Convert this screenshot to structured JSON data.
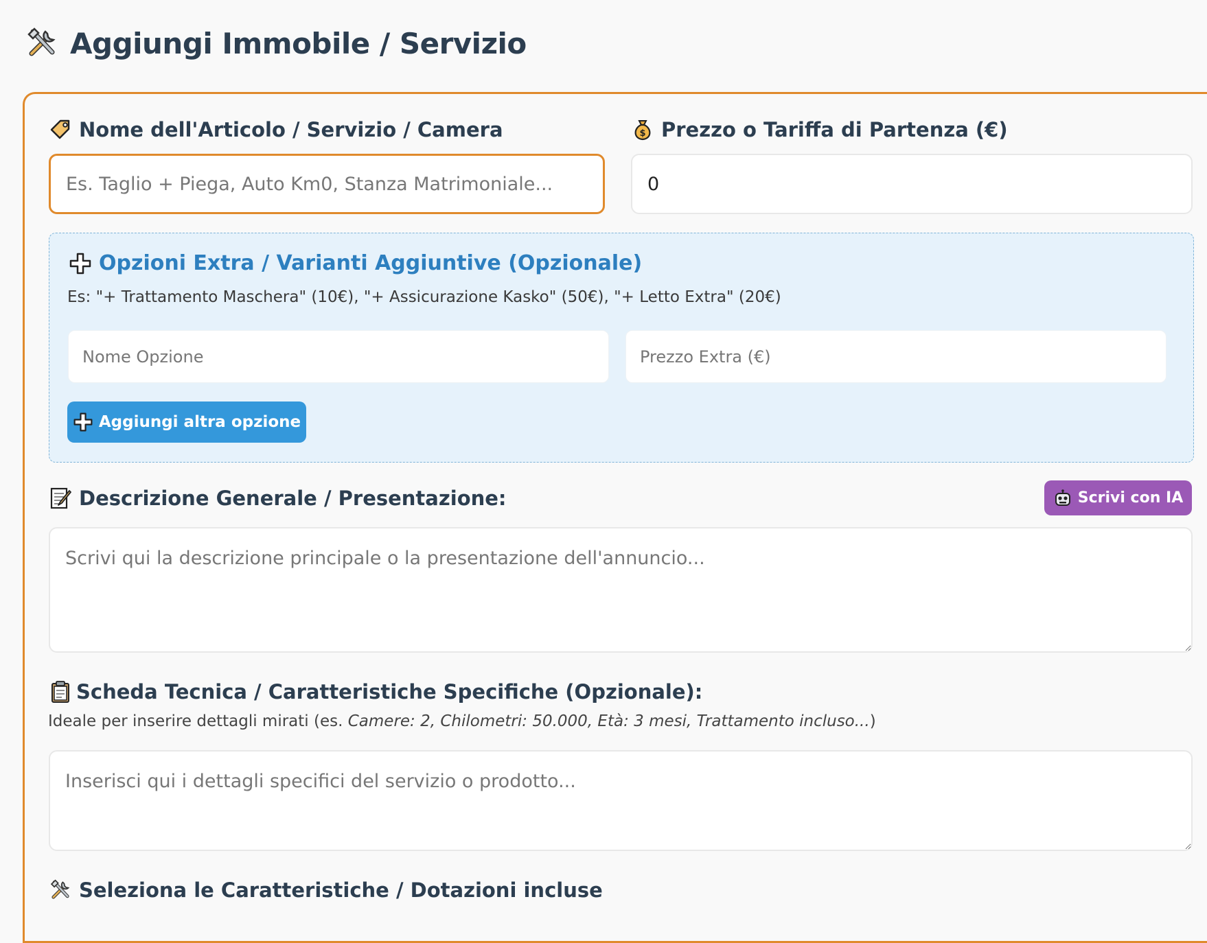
{
  "page": {
    "title": "Aggiungi Immobile / Servizio",
    "title_icon": "tools-icon"
  },
  "form": {
    "name_field": {
      "label": "Nome dell'Articolo / Servizio / Camera",
      "icon": "tag-icon",
      "value": "",
      "placeholder": "Es. Taglio + Piega, Auto Km0, Stanza Matrimoniale..."
    },
    "price_field": {
      "label": "Prezzo o Tariffa di Partenza (€)",
      "icon": "money-bag-icon",
      "value": "0",
      "placeholder": ""
    },
    "extras": {
      "title": "Opzioni Extra / Varianti Aggiuntive (Opzionale)",
      "icon": "plus-icon",
      "hint": "Es: \"+ Trattamento Maschera\" (10€), \"+ Assicurazione Kasko\" (50€), \"+ Letto Extra\" (20€)",
      "option_name_placeholder": "Nome Opzione",
      "option_price_placeholder": "Prezzo Extra (€)",
      "add_button": "Aggiungi altra opzione"
    },
    "description": {
      "label": "Descrizione Generale / Presentazione:",
      "icon": "memo-icon",
      "ai_button": "Scrivi con IA",
      "ai_icon": "robot-icon",
      "placeholder": "Scrivi qui la descrizione principale o la presentazione dell'annuncio..."
    },
    "specs": {
      "label": "Scheda Tecnica / Caratteristiche Specifiche (Opzionale):",
      "icon": "clipboard-icon",
      "hint_prefix": "Ideale per inserire dettagli mirati (es. ",
      "hint_example": "Camere: 2, Chilometri: 50.000, Età: 3 mesi, Trattamento incluso...",
      "hint_suffix": ")",
      "placeholder": "Inserisci qui i dettagli specifici del servizio o prodotto..."
    },
    "features": {
      "label": "Seleziona le Caratteristiche / Dotazioni incluse",
      "icon": "tools-icon"
    }
  },
  "colors": {
    "accent_orange": "#e08a2c",
    "primary_blue": "#3498db",
    "extras_bg": "#e6f2fb",
    "ai_purple": "#9b59b6",
    "text_dark": "#2c3e50"
  }
}
